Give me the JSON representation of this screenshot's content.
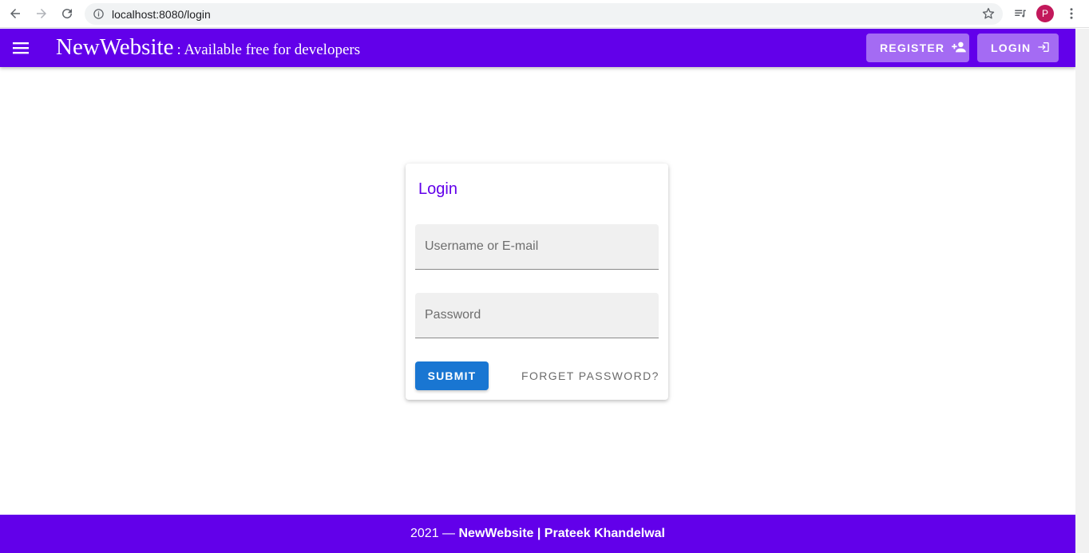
{
  "browser": {
    "url": "localhost:8080/login",
    "profile_initial": "P"
  },
  "appbar": {
    "brand_name": "NewWebsite",
    "brand_tagline": ": Available free for developers",
    "register_label": "REGISTER",
    "login_label": "LOGIN",
    "color": "#6200ea"
  },
  "login_card": {
    "title": "Login",
    "username_placeholder": "Username or E-mail",
    "username_value": "",
    "password_placeholder": "Password",
    "password_value": "",
    "submit_label": "SUBMIT",
    "forget_label": "FORGET PASSWORD?",
    "submit_color": "#1976d2"
  },
  "footer": {
    "year": "2021",
    "separator": " — ",
    "credit": "NewWebsite | Prateek Khandelwal"
  },
  "icons": [
    "back-icon",
    "forward-icon",
    "reload-icon",
    "info-icon",
    "star-icon",
    "reading-list-icon",
    "more-vert-icon",
    "menu-icon",
    "person-add-icon",
    "login-icon"
  ]
}
